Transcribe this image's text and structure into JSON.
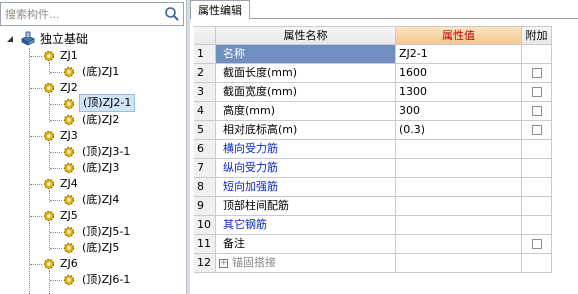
{
  "search": {
    "placeholder": "搜索构件..."
  },
  "tree": {
    "root": "独立基础",
    "items": [
      {
        "label": "ZJ1",
        "level": 1
      },
      {
        "label": "(底)ZJ1",
        "level": 2
      },
      {
        "label": "ZJ2",
        "level": 1
      },
      {
        "label": "(顶)ZJ2-1",
        "level": 2,
        "selected": true
      },
      {
        "label": "(底)ZJ2",
        "level": 2
      },
      {
        "label": "ZJ3",
        "level": 1
      },
      {
        "label": "(顶)ZJ3-1",
        "level": 2
      },
      {
        "label": "(底)ZJ3",
        "level": 2
      },
      {
        "label": "ZJ4",
        "level": 1
      },
      {
        "label": "(底)ZJ4",
        "level": 2
      },
      {
        "label": "ZJ5",
        "level": 1
      },
      {
        "label": "(顶)ZJ5-1",
        "level": 2
      },
      {
        "label": "(底)ZJ5",
        "level": 2
      },
      {
        "label": "ZJ6",
        "level": 1
      },
      {
        "label": "(顶)ZJ6-1",
        "level": 2
      }
    ]
  },
  "tab": {
    "label": "属性编辑"
  },
  "grid": {
    "headers": {
      "name": "属性名称",
      "value": "属性值",
      "add": "附加"
    },
    "rows": [
      {
        "num": "1",
        "name": "名称",
        "value": "ZJ2-1",
        "style": "selected",
        "checkbox": false
      },
      {
        "num": "2",
        "name": "截面长度(mm)",
        "value": "1600",
        "style": "normal",
        "checkbox": true
      },
      {
        "num": "3",
        "name": "截面宽度(mm)",
        "value": "1300",
        "style": "normal",
        "checkbox": true
      },
      {
        "num": "4",
        "name": "高度(mm)",
        "value": "300",
        "style": "normal",
        "checkbox": true
      },
      {
        "num": "5",
        "name": "相对底标高(m)",
        "value": "(0.3)",
        "style": "normal",
        "checkbox": true
      },
      {
        "num": "6",
        "name": "横向受力筋",
        "value": "",
        "style": "blue",
        "checkbox": false
      },
      {
        "num": "7",
        "name": "纵向受力筋",
        "value": "",
        "style": "blue",
        "checkbox": false
      },
      {
        "num": "8",
        "name": "短向加强筋",
        "value": "",
        "style": "blue",
        "checkbox": false
      },
      {
        "num": "9",
        "name": "顶部柱间配筋",
        "value": "",
        "style": "normal",
        "checkbox": false
      },
      {
        "num": "10",
        "name": "其它钢筋",
        "value": "",
        "style": "blue",
        "checkbox": false
      },
      {
        "num": "11",
        "name": "备注",
        "value": "",
        "style": "normal",
        "checkbox": true
      },
      {
        "num": "12",
        "name": "锚固搭接",
        "value": "",
        "style": "gray-expand",
        "checkbox": false
      }
    ]
  },
  "colors": {
    "selected_row": "#6e8fbf",
    "blue_text": "#0a28c8",
    "value_header": "#f5c78c"
  }
}
